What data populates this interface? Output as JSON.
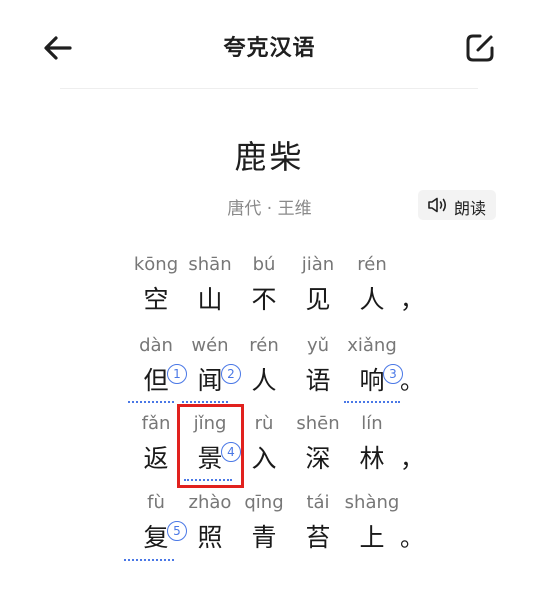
{
  "header": {
    "title": "夸克汉语",
    "back_icon": "arrow-left-icon",
    "edit_icon": "edit-square-icon"
  },
  "poem": {
    "title": "鹿柴",
    "author_line": "唐代 · 王维",
    "read_label": "朗读",
    "read_icon": "speaker-icon"
  },
  "lines": [
    {
      "chars": [
        {
          "py": "kōng",
          "hz": "空"
        },
        {
          "py": "shān",
          "hz": "山"
        },
        {
          "py": "bú",
          "hz": "不"
        },
        {
          "py": "jiàn",
          "hz": "见"
        },
        {
          "py": "rén",
          "hz": "人"
        }
      ],
      "punct": "，"
    },
    {
      "chars": [
        {
          "py": "dàn",
          "hz": "但",
          "note": "1"
        },
        {
          "py": "wén",
          "hz": "闻",
          "note": "2"
        },
        {
          "py": "rén",
          "hz": "人"
        },
        {
          "py": "yǔ",
          "hz": "语"
        },
        {
          "py": "xiǎng",
          "hz": "响",
          "note": "3"
        }
      ],
      "punct": "。"
    },
    {
      "chars": [
        {
          "py": "fǎn",
          "hz": "返"
        },
        {
          "py": "jǐng",
          "hz": "景",
          "note": "4"
        },
        {
          "py": "rù",
          "hz": "入"
        },
        {
          "py": "shēn",
          "hz": "深"
        },
        {
          "py": "lín",
          "hz": "林"
        }
      ],
      "punct": "，"
    },
    {
      "chars": [
        {
          "py": "fù",
          "hz": "复",
          "note": "5"
        },
        {
          "py": "zhào",
          "hz": "照"
        },
        {
          "py": "qīng",
          "hz": "青"
        },
        {
          "py": "tái",
          "hz": "苔"
        },
        {
          "py": "shàng",
          "hz": "上"
        }
      ],
      "punct": "。"
    }
  ],
  "colors": {
    "annotation": "#4a78e6",
    "highlight_box": "#e1211e"
  }
}
